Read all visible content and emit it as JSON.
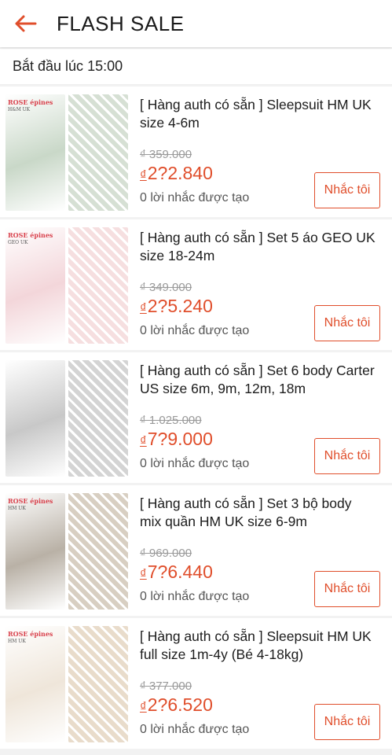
{
  "header": {
    "title": "FLASH SALE",
    "back_icon": "arrow-left-icon",
    "accent": "#e04e2b"
  },
  "start_time_label": "Bắt đầu lúc 15:00",
  "products": [
    {
      "name": "[ Hàng auth có sẵn ] Sleepsuit HM UK size 4-6m",
      "old_price": "₫ 359.000",
      "currency": "₫",
      "price": "2?2.840",
      "reminders": "0 lời nhắc được tạo",
      "button": "Nhắc tôi",
      "brand": "ROSE épines",
      "brand_sub": "H&M UK",
      "colors": [
        "#c9d8c8",
        "#d6e0d4"
      ]
    },
    {
      "name": "[ Hàng auth có sẵn ] Set 5 áo GEO UK size 18-24m",
      "old_price": "₫ 349.000",
      "currency": "₫",
      "price": "2?5.240",
      "reminders": "0 lời nhắc được tạo",
      "button": "Nhắc tôi",
      "brand": "ROSE épines",
      "brand_sub": "GEO UK",
      "colors": [
        "#f3d6da",
        "#f6dfe0"
      ]
    },
    {
      "name": "[ Hàng auth có sẵn ] Set 6 body Carter US size 6m, 9m, 12m, 18m",
      "old_price": "₫ 1.025.000",
      "currency": "₫",
      "price": "7?9.000",
      "reminders": "0 lời nhắc được tạo",
      "button": "Nhắc tôi",
      "brand": "",
      "brand_sub": "",
      "colors": [
        "#c8c8c8",
        "#d4d4d4"
      ]
    },
    {
      "name": "[ Hàng auth có sẵn ] Set 3 bộ body mix quần HM UK size 6-9m",
      "old_price": "₫ 969.000",
      "currency": "₫",
      "price": "7?6.440",
      "reminders": "0 lời nhắc được tạo",
      "button": "Nhắc tôi",
      "brand": "ROSE épines",
      "brand_sub": "HM UK",
      "colors": [
        "#b9b1a6",
        "#d8cfc2"
      ]
    },
    {
      "name": "[ Hàng auth có sẵn ] Sleepsuit HM UK full size 1m-4y (Bé 4-18kg)",
      "old_price": "₫ 377.000",
      "currency": "₫",
      "price": "2?6.520",
      "reminders": "0 lời nhắc được tạo",
      "button": "Nhắc tôi",
      "brand": "ROSE épines",
      "brand_sub": "HM UK",
      "colors": [
        "#efe6da",
        "#e9dccb"
      ]
    }
  ]
}
